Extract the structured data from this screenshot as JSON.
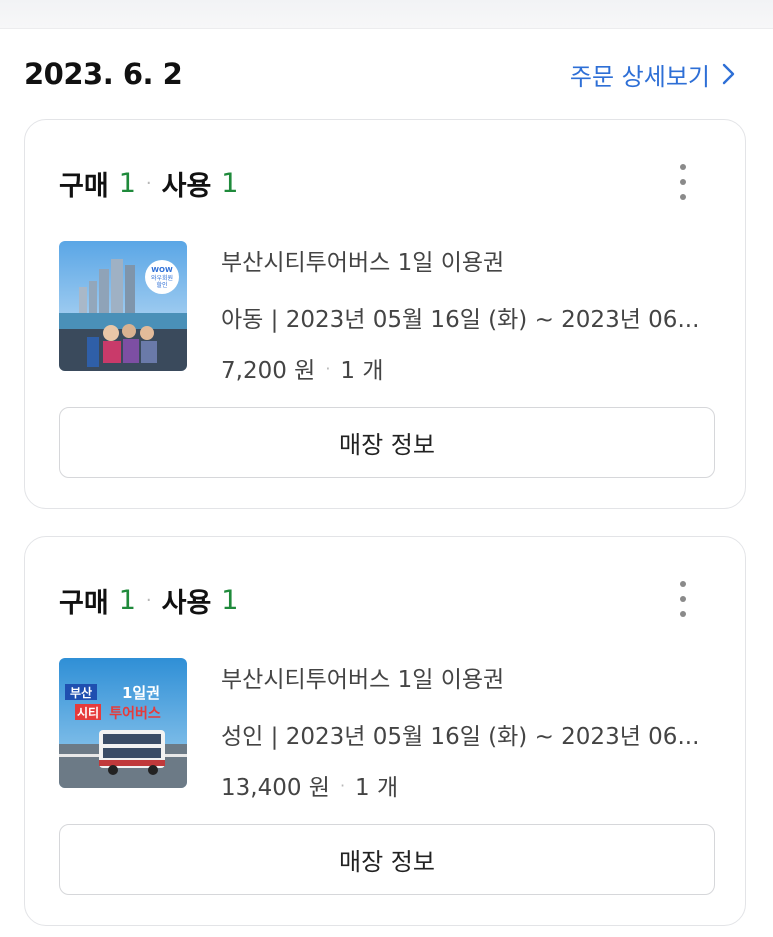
{
  "order": {
    "date": "2023. 6. 2",
    "detail_link": "주문 상세보기"
  },
  "cards": [
    {
      "purchase_label": "구매",
      "purchase_count": "1",
      "use_label": "사용",
      "use_count": "1",
      "product_name": "부산시티투어버스 1일 이용권",
      "option_text": "아동 | 2023년 05월 16일 (화) ~ 2023년 06...",
      "price": "7,200 원",
      "quantity": "1 개",
      "store_button": "매장 정보",
      "thumbnail_icon": "busan-skyline-tour-photo",
      "thumbnail_badge": [
        "WOW",
        "와우회원",
        "할인"
      ]
    },
    {
      "purchase_label": "구매",
      "purchase_count": "1",
      "use_label": "사용",
      "use_count": "1",
      "product_name": "부산시티투어버스 1일 이용권",
      "option_text": "성인 | 2023년 05월 16일 (화) ~ 2023년 06...",
      "price": "13,400 원",
      "quantity": "1 개",
      "store_button": "매장 정보",
      "thumbnail_icon": "double-decker-bus-photo",
      "thumbnail_text": [
        "부산",
        "1일권",
        "시티",
        "투어버스"
      ]
    }
  ],
  "colors": {
    "link": "#2e6fd6",
    "count": "#1f8a3b"
  }
}
